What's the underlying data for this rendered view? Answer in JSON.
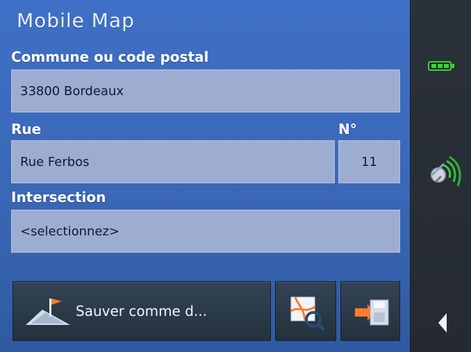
{
  "app": {
    "title": "Mobile Map"
  },
  "labels": {
    "commune": "Commune ou code postal",
    "rue": "Rue",
    "numero": "N°",
    "intersection": "Intersection"
  },
  "fields": {
    "commune_value": "33800 Bordeaux",
    "rue_value": "Rue Ferbos",
    "numero_value": "11",
    "intersection_value": "<selectionnez>"
  },
  "toolbar": {
    "save_label": "Sauver comme d..."
  },
  "icons": {
    "battery": "battery-icon",
    "gps": "gps-signal-icon",
    "back": "back-arrow-icon",
    "route": "route-flag-icon",
    "map_search": "map-search-icon",
    "save": "save-icon"
  },
  "colors": {
    "main_bg": "#3a67b6",
    "field_bg": "#9dadd2",
    "sidebar_bg": "#252a31",
    "accent_green": "#36d13b"
  }
}
